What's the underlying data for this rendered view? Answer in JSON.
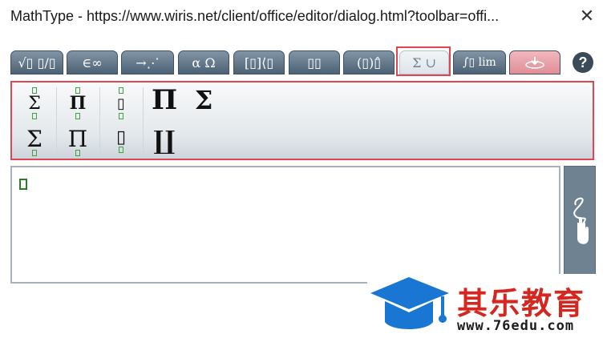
{
  "window": {
    "title": "MathType - https://www.wiris.net/client/office/editor/dialog.html?toolbar=offi...",
    "close_label": "✕"
  },
  "tabs": [
    {
      "label": "√▯ ▯/▯",
      "icon": "radicals-fractions-icon"
    },
    {
      "label": "∈∞",
      "icon": "symbols-icon"
    },
    {
      "label": "→⋰",
      "icon": "arrows-icon"
    },
    {
      "label": "α Ω",
      "icon": "greek-icon"
    },
    {
      "label": "[▯]⟨▯",
      "icon": "matrices-icon"
    },
    {
      "label": "▯▯",
      "icon": "scripts-icon"
    },
    {
      "label": "(▯)▯̂",
      "icon": "brackets-accents-icon"
    },
    {
      "label": "Σ ∪",
      "icon": "big-operators-icon",
      "active": true
    },
    {
      "label": "∫▯ lim",
      "icon": "calculus-icon"
    },
    {
      "label": "",
      "icon": "contextual-icon"
    }
  ],
  "help_label": "?",
  "panel": {
    "tools": [
      {
        "symbol": "Σ",
        "name": "sum-over-under-icon"
      },
      {
        "symbol": "Π",
        "name": "product-over-under-icon"
      },
      {
        "symbol": "▯",
        "name": "generic-operator-over-under-icon"
      },
      {
        "symbol": "Π",
        "name": "product-big-icon"
      },
      {
        "symbol": "Σ",
        "name": "sum-big-icon"
      },
      {
        "symbol": "Σ",
        "name": "sum-under-icon"
      },
      {
        "symbol": "Π",
        "name": "product-under-icon"
      },
      {
        "symbol": "▯",
        "name": "generic-operator-under-icon"
      },
      {
        "symbol": "∐",
        "name": "coproduct-big-icon"
      }
    ]
  },
  "watermark": {
    "text": "其乐教育",
    "url": "www.76edu.com"
  },
  "colors": {
    "accent_red": "#e0464f",
    "tab_blue": "#4c6274",
    "placeholder_green": "#3fa33f",
    "watermark_blue": "#1976d2",
    "watermark_red": "#d52620"
  }
}
